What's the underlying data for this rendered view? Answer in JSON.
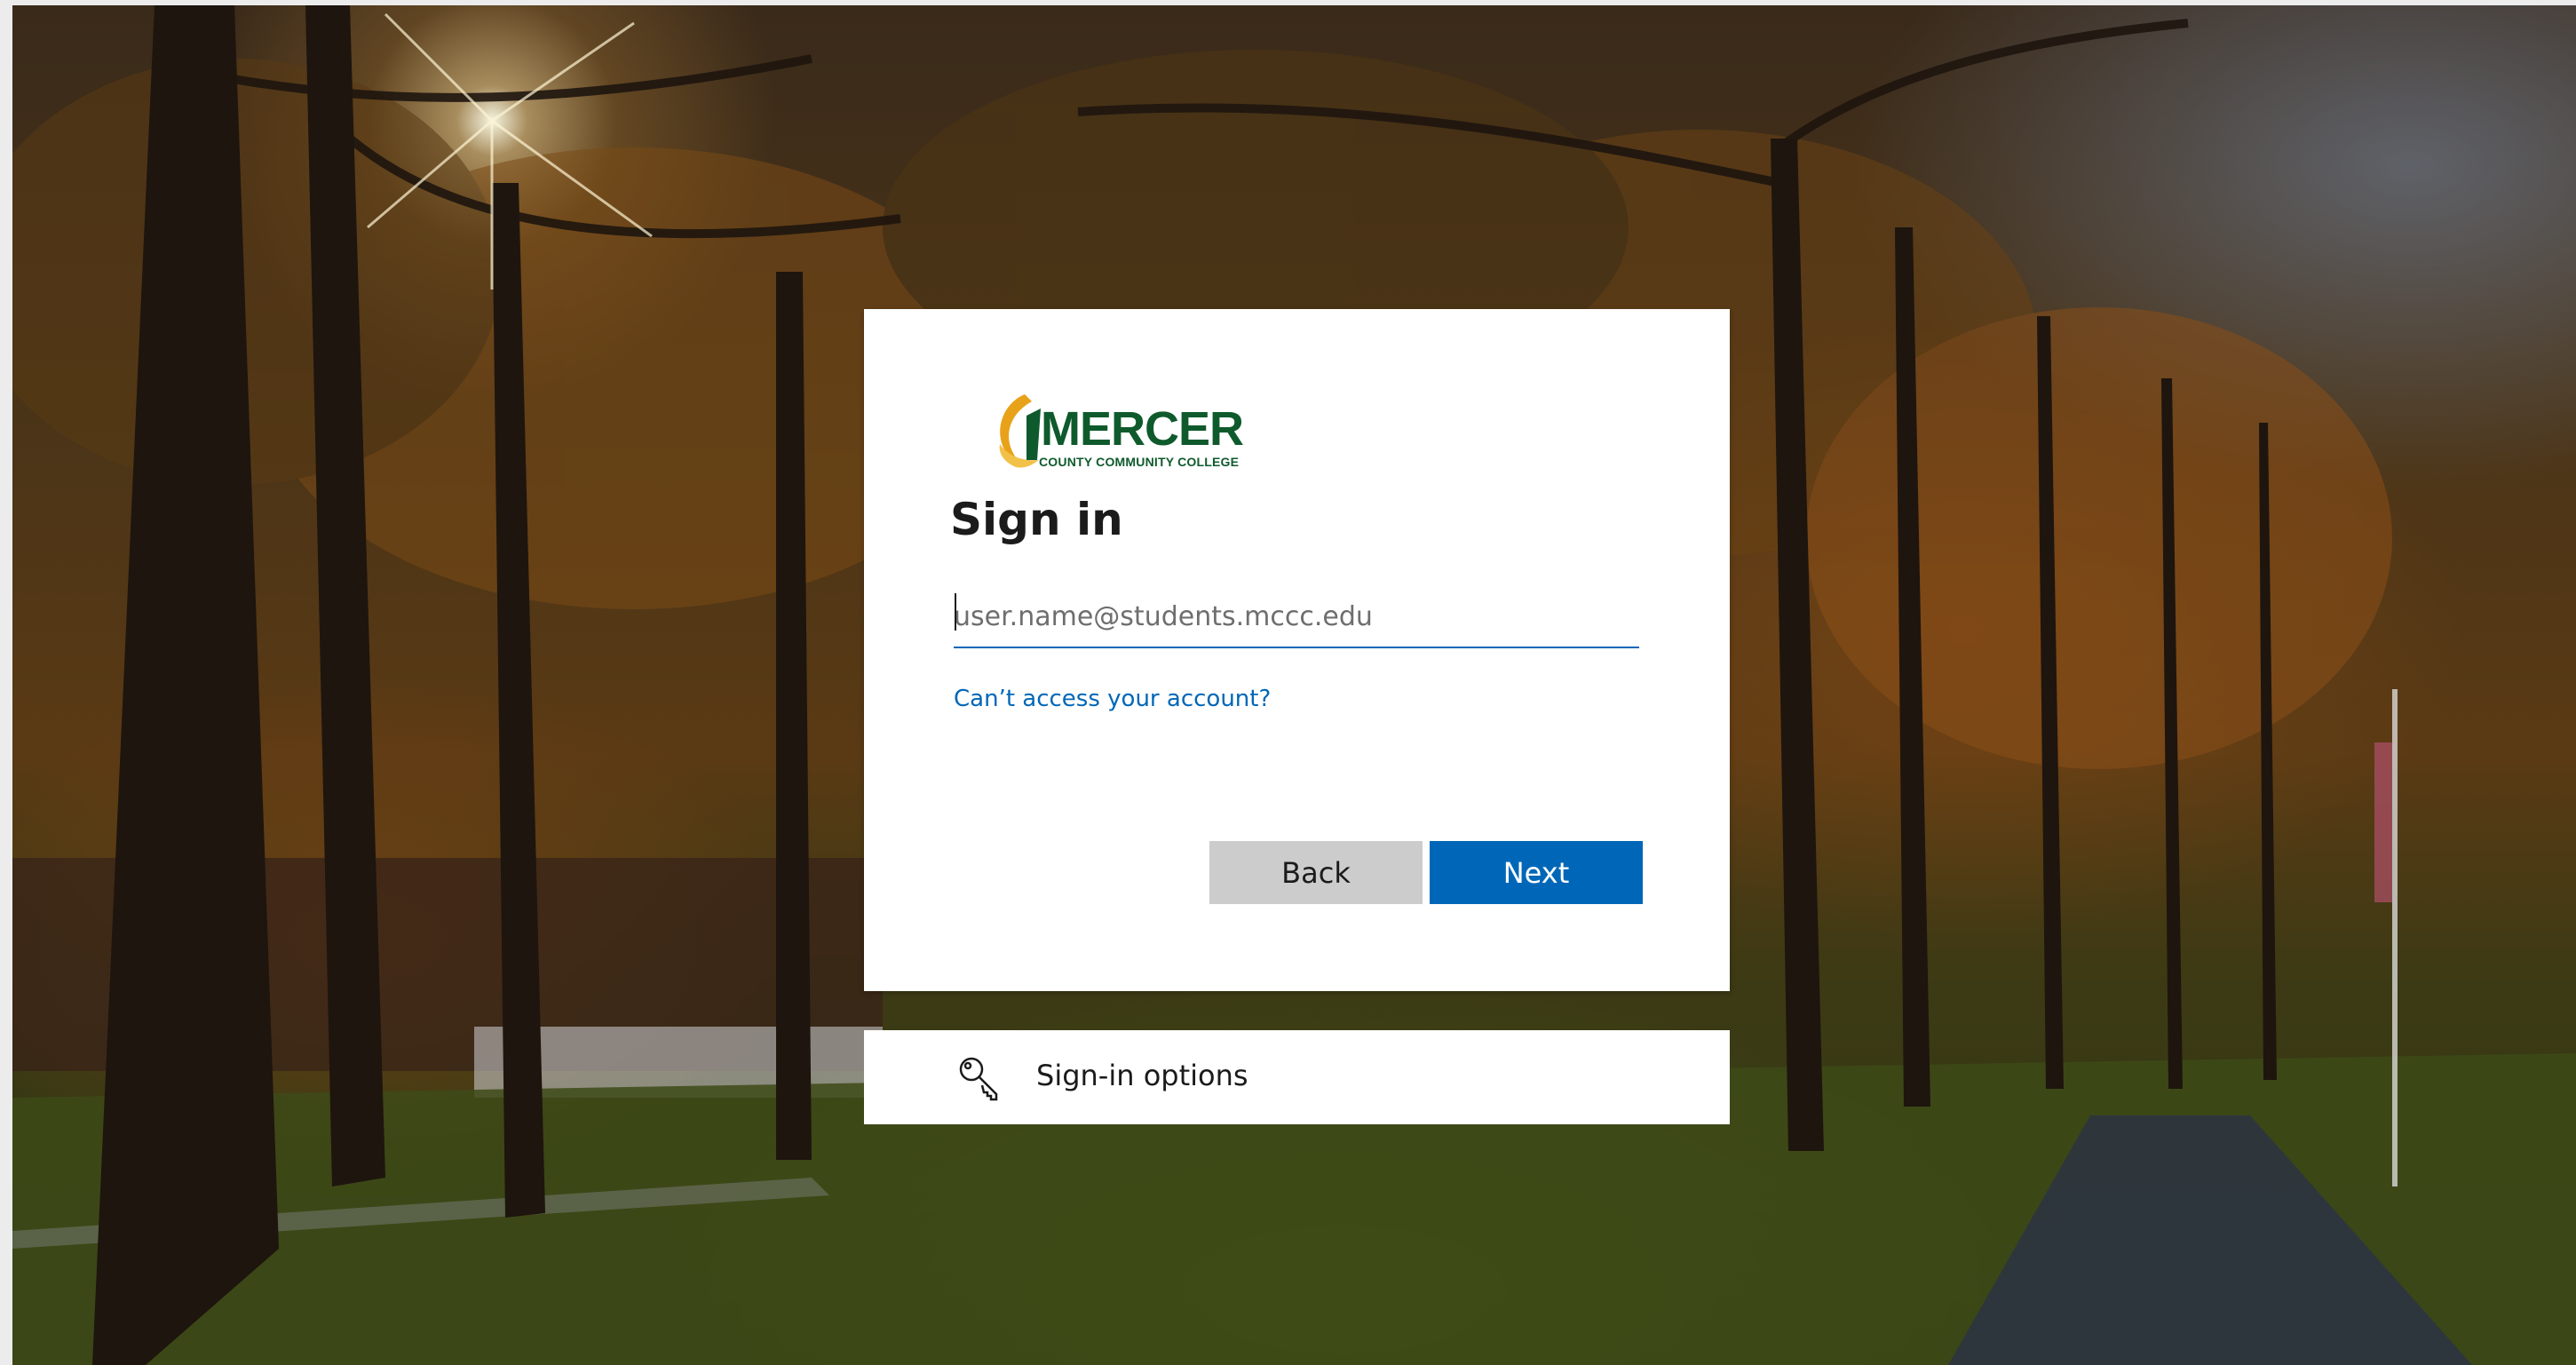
{
  "logo": {
    "name": "MERCER",
    "tagline": "COUNTY COMMUNITY COLLEGE"
  },
  "signin": {
    "title": "Sign in",
    "email_placeholder": "user.name@students.mccc.edu",
    "email_value": "",
    "cant_access_link": "Can’t access your account?",
    "back_label": "Back",
    "next_label": "Next"
  },
  "signin_options": {
    "label": "Sign-in options",
    "icon": "key-icon"
  },
  "colors": {
    "accent": "#0067b8",
    "back_button": "#cccccc",
    "logo_green": "#0f5a2c",
    "logo_gold": "#e8a21a"
  }
}
